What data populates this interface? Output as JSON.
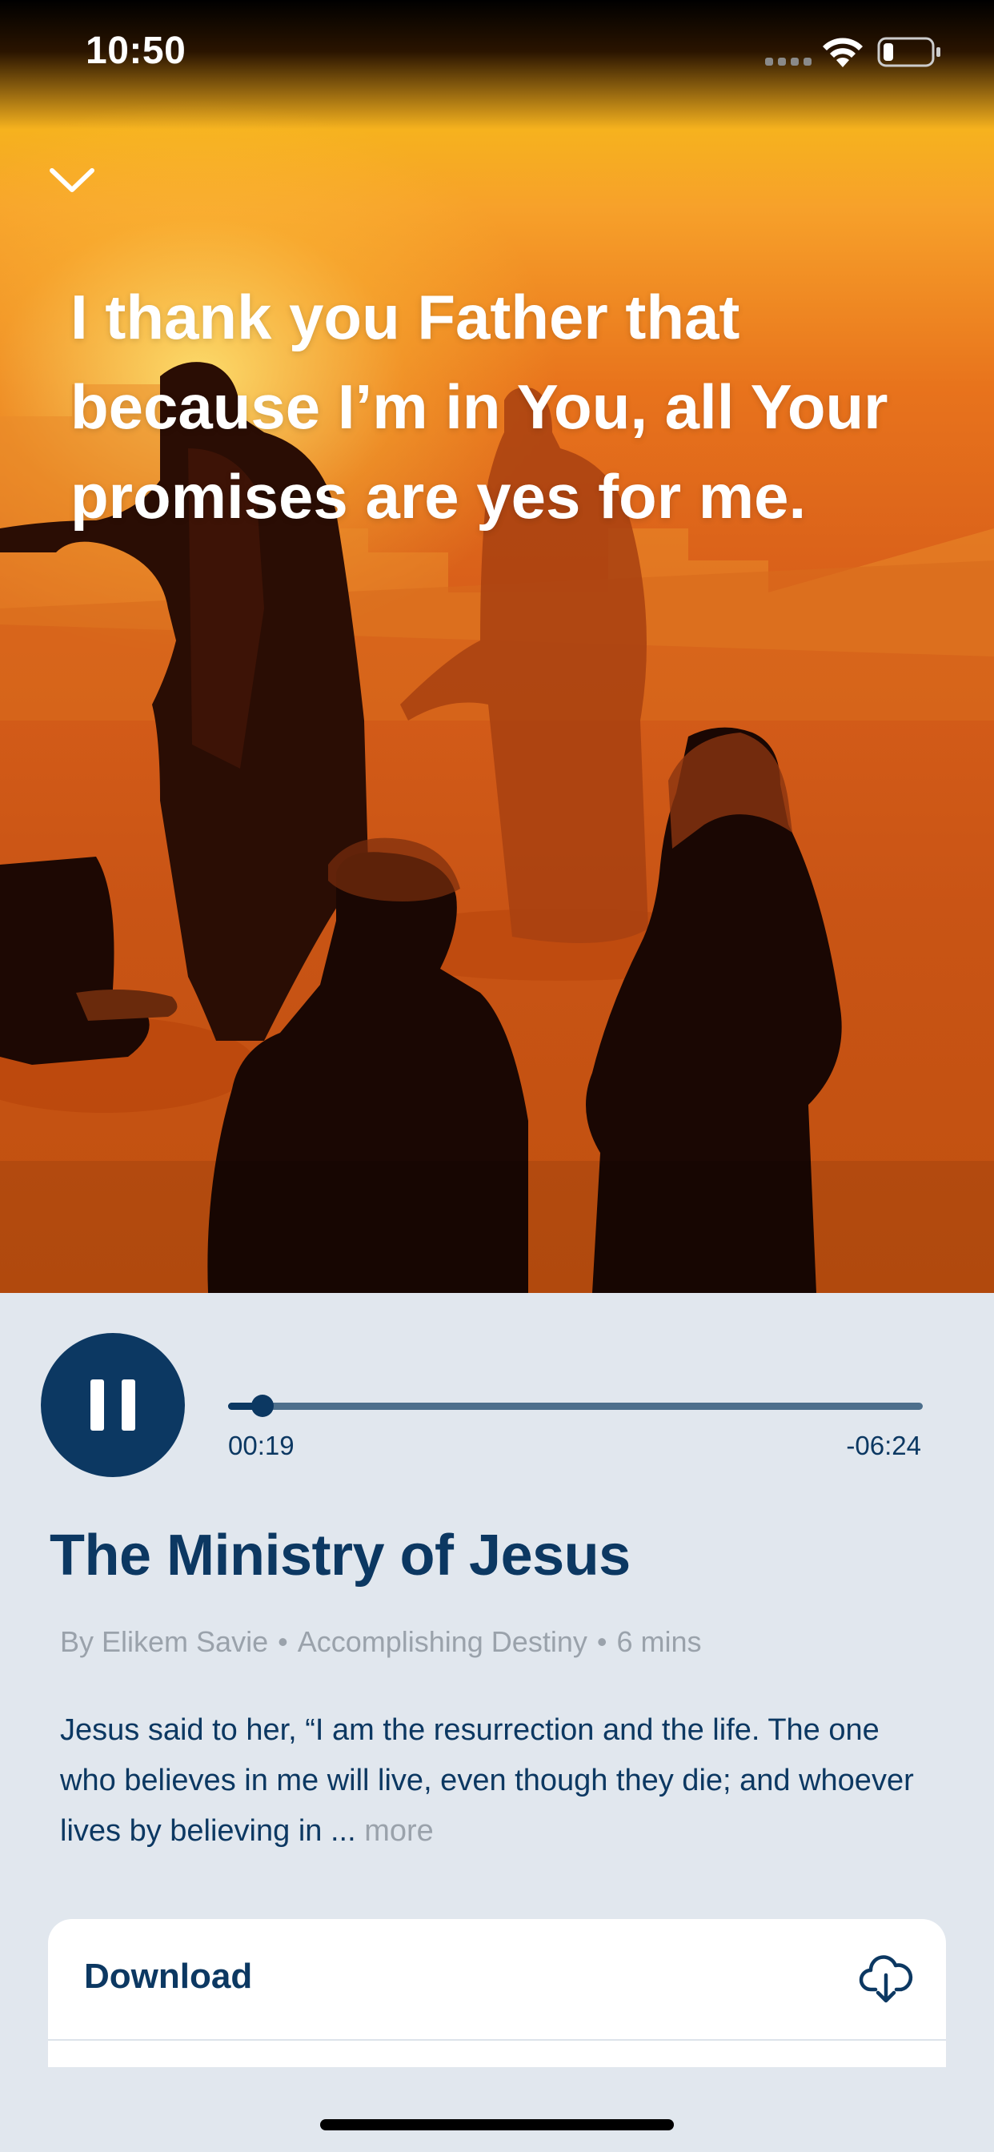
{
  "status_bar": {
    "time": "10:50",
    "icons": [
      "signal-icon",
      "wifi-icon",
      "battery-icon"
    ]
  },
  "hero": {
    "collapse_icon": "chevron-down-icon",
    "quote": "I thank you Father that because I’m in You, all Your promises are yes for me."
  },
  "player": {
    "state_icon": "pause-icon",
    "elapsed": "00:19",
    "remaining": "-06:24",
    "progress_fraction": 0.05
  },
  "episode": {
    "title": "The Ministry of Jesus",
    "author": "By Elikem Savie",
    "series": "Accomplishing Destiny",
    "duration": "6 mins",
    "separator": "•",
    "description": "Jesus said to her, “I am the resurrection and the life. The one who believes in me will live, even though they die; and whoever lives by believing in ...",
    "more_label": "more"
  },
  "actions": {
    "download_label": "Download",
    "download_icon": "cloud-download-icon"
  },
  "colors": {
    "navy": "#0c3862",
    "background": "#e1e7ee",
    "muted": "#9aa2ab"
  }
}
